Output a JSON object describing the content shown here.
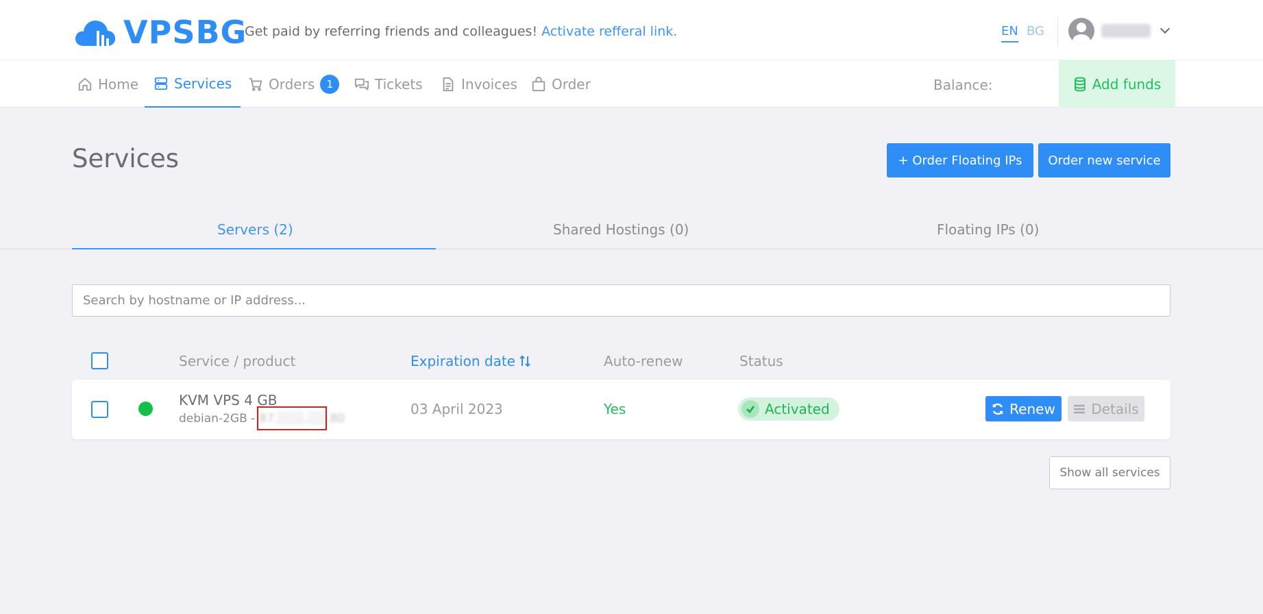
{
  "brand": {
    "name": "VPSBG",
    "color": "#2e8ef5"
  },
  "header": {
    "referral_text": "Get paid by referring friends and colleagues!",
    "referral_link": "Activate refferal link.",
    "lang_en": "EN",
    "lang_bg": "BG"
  },
  "nav": {
    "items": [
      {
        "label": "Home",
        "icon": "home-icon"
      },
      {
        "label": "Services",
        "icon": "server-icon",
        "active": true
      },
      {
        "label": "Orders",
        "icon": "cart-icon",
        "badge": "1"
      },
      {
        "label": "Tickets",
        "icon": "chat-icon"
      },
      {
        "label": "Invoices",
        "icon": "document-icon"
      },
      {
        "label": "Order",
        "icon": "bag-icon"
      }
    ],
    "balance_label": "Balance:",
    "add_funds": "Add funds"
  },
  "page": {
    "title": "Services",
    "order_floating": "+ Order Floating IPs",
    "order_new": "Order new service"
  },
  "tabs": [
    {
      "label": "Servers (2)",
      "active": true
    },
    {
      "label": "Shared Hostings (0)"
    },
    {
      "label": "Floating IPs (0)"
    }
  ],
  "search": {
    "placeholder": "Search by hostname or IP address..."
  },
  "table": {
    "headers": {
      "service": "Service / product",
      "expiration": "Expiration date",
      "autorenew": "Auto-renew",
      "status": "Status"
    },
    "rows": [
      {
        "name": "KVM VPS 4 GB",
        "hostname": "debian-2GB -",
        "ip": "87.░░░.░░.80",
        "expiration": "03 April 2023",
        "autorenew": "Yes",
        "status": "Activated",
        "renew": "Renew",
        "details": "Details"
      }
    ]
  },
  "show_all": "Show all services",
  "colors": {
    "accent": "#2e8ef5",
    "success": "#1fc05c",
    "online": "#12c04a",
    "highlight": "#e11b1b"
  }
}
